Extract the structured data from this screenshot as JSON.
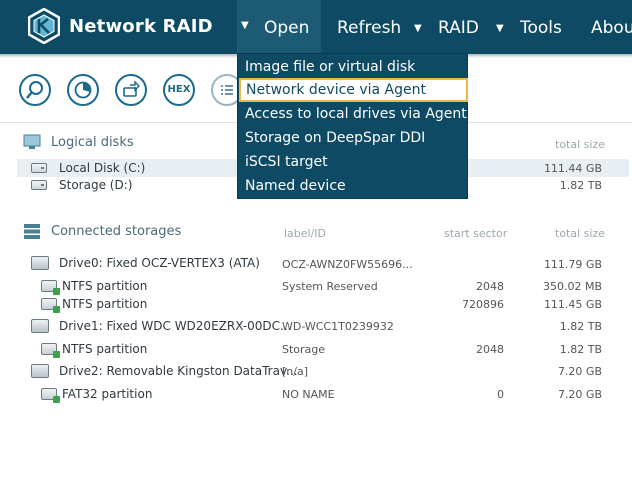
{
  "app": {
    "title": "Network RAID"
  },
  "menu": {
    "open": "Open",
    "refresh": "Refresh",
    "raid": "RAID",
    "tools": "Tools",
    "about": "About"
  },
  "dropdown": {
    "items": [
      "Image file or virtual disk",
      "Network device via Agent",
      "Access to local drives via Agent",
      "Storage on DeepSpar DDI",
      "iSCSI target",
      "Named device"
    ]
  },
  "toolbar": {
    "hex_label": "HEX"
  },
  "logical": {
    "title": "Logical disks",
    "col_total": "total size",
    "rows": [
      {
        "name": "Local Disk (C:)",
        "size": "111.44 GB"
      },
      {
        "name": "Storage (D:)",
        "size": "1.82 TB"
      }
    ]
  },
  "storages": {
    "title": "Connected storages",
    "col_label": "label/ID",
    "col_start": "start sector",
    "col_total": "total size",
    "rows": [
      {
        "name": "Drive0: Fixed OCZ-VERTEX3 (ATA)",
        "label": "OCZ-AWNZ0FW55696...",
        "start": "",
        "size": "111.79 GB"
      },
      {
        "name": "NTFS partition",
        "label": "System Reserved",
        "start": "2048",
        "size": "350.02 MB"
      },
      {
        "name": "NTFS partition",
        "label": "",
        "start": "720896",
        "size": "111.45 GB"
      },
      {
        "name": "Drive1: Fixed WDC WD20EZRX-00DC...",
        "label": "WD-WCC1T0239932",
        "start": "",
        "size": "1.82 TB"
      },
      {
        "name": "NTFS partition",
        "label": "Storage",
        "start": "2048",
        "size": "1.82 TB"
      },
      {
        "name": "Drive2: Removable Kingston DataTrav...",
        "label": "[n/a]",
        "start": "",
        "size": "7.20 GB"
      },
      {
        "name": "FAT32 partition",
        "label": "NO NAME",
        "start": "0",
        "size": "7.20 GB"
      }
    ]
  }
}
